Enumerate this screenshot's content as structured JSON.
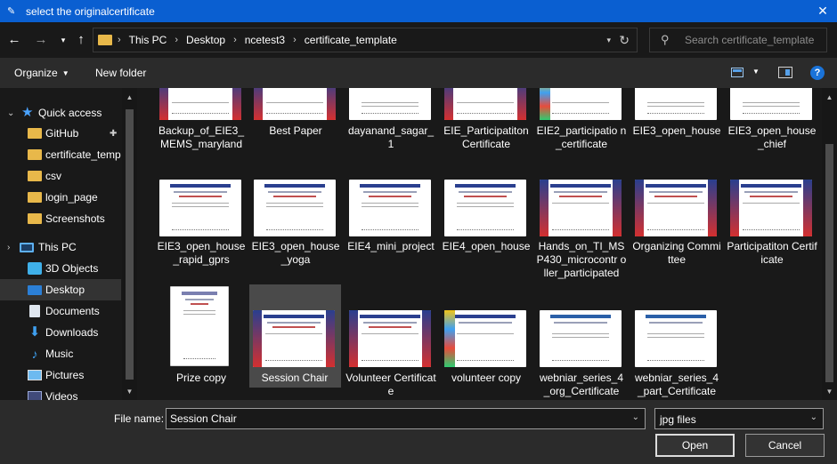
{
  "window": {
    "title": "select the originalcertificate"
  },
  "address": {
    "crumbs": [
      "This PC",
      "Desktop",
      "ncetest3",
      "certificate_template"
    ]
  },
  "search": {
    "placeholder": "Search certificate_template"
  },
  "toolbar": {
    "organize_label": "Organize",
    "new_folder_label": "New folder"
  },
  "sidebar": {
    "items": [
      {
        "label": "Quick access",
        "icon": "star-icon"
      },
      {
        "label": "GitHub",
        "icon": "folder-icon",
        "pinned": true
      },
      {
        "label": "certificate_temp",
        "icon": "folder-icon"
      },
      {
        "label": "csv",
        "icon": "folder-icon"
      },
      {
        "label": "login_page",
        "icon": "folder-icon"
      },
      {
        "label": "Screenshots",
        "icon": "folder-icon"
      },
      {
        "label": "This PC",
        "icon": "computer-icon"
      },
      {
        "label": "3D Objects",
        "icon": "cube-icon"
      },
      {
        "label": "Desktop",
        "icon": "desktop-icon",
        "selected": true
      },
      {
        "label": "Documents",
        "icon": "documents-icon"
      },
      {
        "label": "Downloads",
        "icon": "download-icon"
      },
      {
        "label": "Music",
        "icon": "music-icon"
      },
      {
        "label": "Pictures",
        "icon": "pictures-icon"
      },
      {
        "label": "Videos",
        "icon": "videos-icon"
      }
    ]
  },
  "files": [
    {
      "name": "Backup_of_EIE3_ MEMS_maryland"
    },
    {
      "name": "Best Paper"
    },
    {
      "name": "dayanand_sagar_ 1"
    },
    {
      "name": "EIE_Participatiton Certificate"
    },
    {
      "name": "EIE2_participatio n_certificate"
    },
    {
      "name": "EIE3_open_house"
    },
    {
      "name": "EIE3_open_house _chief"
    },
    {
      "name": "EIE3_open_house _rapid_gprs"
    },
    {
      "name": "EIE3_open_house _yoga"
    },
    {
      "name": "EIE4_mini_project"
    },
    {
      "name": "EIE4_open_house"
    },
    {
      "name": "Hands_on_TI_MS P430_microcontr oller_participated"
    },
    {
      "name": "Organizing Committee"
    },
    {
      "name": "Participatiton Certificate"
    },
    {
      "name": "Prize copy"
    },
    {
      "name": "Session Chair",
      "selected": true
    },
    {
      "name": "Volunteer Certificate"
    },
    {
      "name": "volunteer copy"
    },
    {
      "name": "webniar_series_4 _org_Certificate"
    },
    {
      "name": "webniar_series_4 _part_Certificate"
    }
  ],
  "footer": {
    "file_name_label": "File name:",
    "file_name_value": "Session Chair",
    "file_type_value": "jpg files",
    "open_label": "Open",
    "cancel_label": "Cancel"
  },
  "colors": {
    "accent": "#0a5fd1",
    "background": "#191919",
    "panel": "#2b2b2b"
  }
}
